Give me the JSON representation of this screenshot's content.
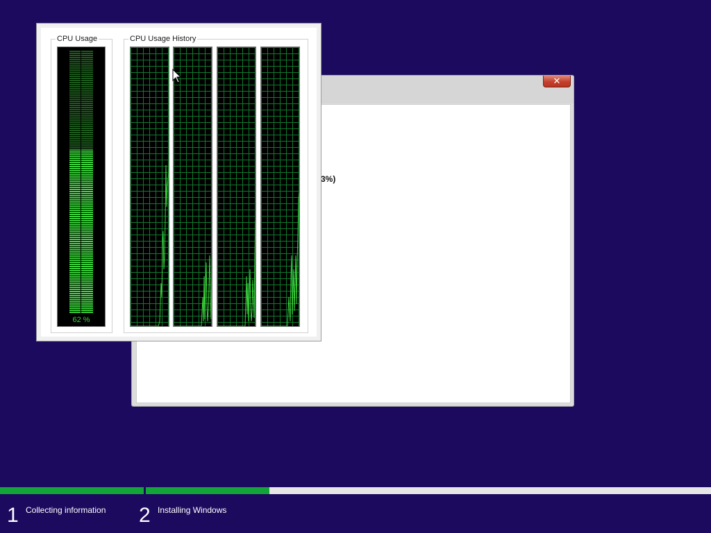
{
  "setup_window": {
    "close_label": "✕",
    "partial_text": "3%)"
  },
  "cpu_monitor": {
    "usage_title": "CPU Usage",
    "history_title": "CPU Usage History",
    "usage_value": "62 %",
    "usage_fraction": 0.62,
    "colors": {
      "accent": "#39d43a",
      "grid": "#117a2d",
      "background": "#000000"
    }
  },
  "setup_progress": {
    "steps": [
      {
        "number": "1",
        "label": "Collecting information",
        "progress": 1.0
      },
      {
        "number": "2",
        "label": "Installing Windows",
        "progress": 0.219
      }
    ],
    "colors": {
      "fill": "#13a537",
      "track": "#e6e6e6",
      "background": "#1c0a5e"
    }
  }
}
